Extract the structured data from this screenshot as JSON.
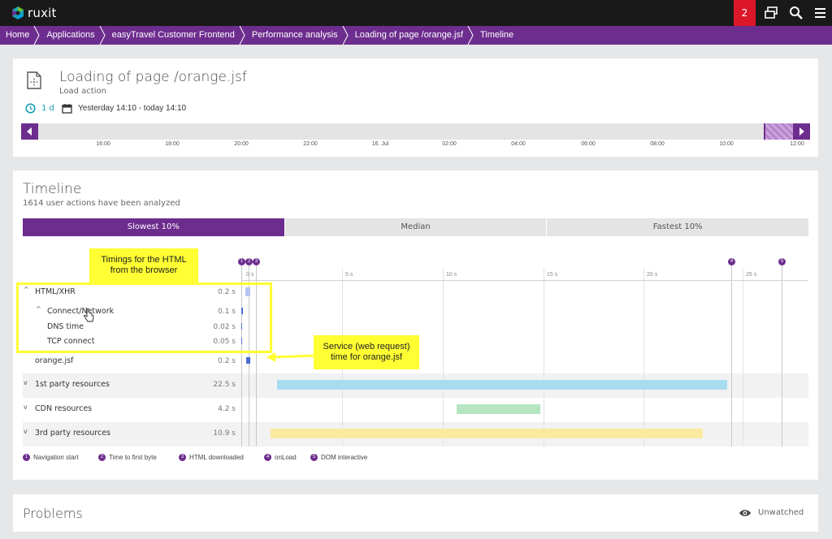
{
  "app": {
    "logo_text": "ruxit",
    "notification_count": "2",
    "brand_color": "#6d2d8e",
    "alert_color": "#dc172a"
  },
  "breadcrumb": [
    "Home",
    "Applications",
    "easyTravel Customer Frontend",
    "Performance analysis",
    "Loading of page /orange.jsf",
    "Timeline"
  ],
  "header": {
    "title": "Loading of page /orange.jsf",
    "subtitle": "Load action",
    "timeframe_label": "1 d",
    "timeframe_range": "Yesterday 14:10 - today 14:10",
    "ticks": [
      "16:00",
      "18:00",
      "20:00",
      "22:00",
      "16. Jul",
      "02:00",
      "04:00",
      "06:00",
      "08:00",
      "10:00",
      "12:00"
    ]
  },
  "timeline": {
    "title": "Timeline",
    "subtitle": "1614 user actions have been analyzed",
    "tabs": [
      {
        "label": "Slowest 10%",
        "active": true
      },
      {
        "label": "Median",
        "active": false
      },
      {
        "label": "Fastest 10%",
        "active": false
      }
    ],
    "scale_labels": [
      "0 s",
      "5 s",
      "10 s",
      "15 s",
      "20 s",
      "25 s"
    ],
    "markers": [
      "1",
      "2",
      "3",
      "4",
      "5"
    ],
    "rows": [
      {
        "name": "HTML/XHR",
        "value": "0.2 s"
      },
      {
        "name": "Connect/Network",
        "value": "0.1 s"
      },
      {
        "name": "DNS time",
        "value": "0.02 s"
      },
      {
        "name": "TCP connect",
        "value": "0.05 s"
      },
      {
        "name": "orange.jsf",
        "value": "0.2 s"
      },
      {
        "name": "1st party resources",
        "value": "22.5 s"
      },
      {
        "name": "CDN resources",
        "value": "4.2 s"
      },
      {
        "name": "3rd party resources",
        "value": "10.9 s"
      }
    ],
    "legend": [
      {
        "num": "1",
        "label": "Navigation start"
      },
      {
        "num": "2",
        "label": "Time to first byte"
      },
      {
        "num": "3",
        "label": "HTML downloaded"
      },
      {
        "num": "4",
        "label": "onLoad"
      },
      {
        "num": "5",
        "label": "DOM interactive"
      }
    ],
    "callouts": {
      "html_timings": "Timings for the HTML from the browser",
      "service": "Service (web request) time for orange.jsf"
    },
    "bar_colors": {
      "first_party": "#a8dcf0",
      "cdn": "#b5e6c1",
      "third_party": "#fbe9a0",
      "html": "#b8c4f2",
      "service": "#4a6bd4"
    }
  },
  "problems": {
    "title": "Problems",
    "watch_label": "Unwatched"
  }
}
